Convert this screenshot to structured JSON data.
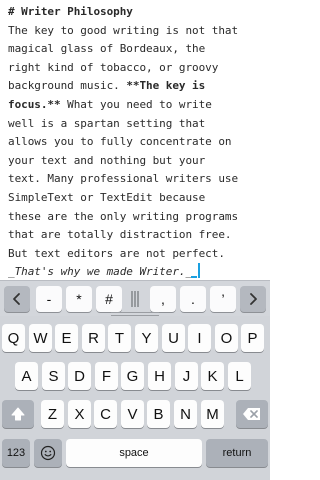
{
  "document": {
    "heading": "# Writer Philosophy",
    "lines": [
      "The key to good writing is not that",
      "magical glass of Bordeaux, the",
      "right kind of tobacco, or groovy"
    ],
    "line4_normal": "background music. ",
    "line4_bold": "**The key is",
    "line5_bold": "focus.**",
    "line5_normal": " What you need to write",
    "lines_rest": [
      "well is a spartan setting that",
      "allows you to fully concentrate on",
      "your text and nothing but your",
      "text. Many professional writers use",
      "SimpleText or TextEdit because",
      "these are the only writing programs",
      "that are totally distraction free.",
      "But text editors are not perfect."
    ],
    "last_line_italic": "_That's why we made Writer._"
  },
  "extra_keys": {
    "keys": [
      "-",
      "*",
      "#",
      ",",
      ".",
      "’"
    ],
    "left_icon": "chevron-left-icon",
    "right_icon": "chevron-right-icon",
    "divider_icon": "divider-icon"
  },
  "keyboard": {
    "row1": [
      "Q",
      "W",
      "E",
      "R",
      "T",
      "Y",
      "U",
      "I",
      "O",
      "P"
    ],
    "row2": [
      "A",
      "S",
      "D",
      "F",
      "G",
      "H",
      "J",
      "K",
      "L"
    ],
    "row3": [
      "Z",
      "X",
      "C",
      "V",
      "B",
      "N",
      "M"
    ],
    "numbers_label": "123",
    "space_label": "space",
    "return_label": "return",
    "shift_icon": "shift-icon",
    "delete_icon": "delete-icon",
    "emoji_icon": "emoji-icon"
  },
  "colors": {
    "caret": "#1aa0e0",
    "keyboard_bg": "#d1d4d9",
    "key_bg": "#fdfdfd"
  }
}
